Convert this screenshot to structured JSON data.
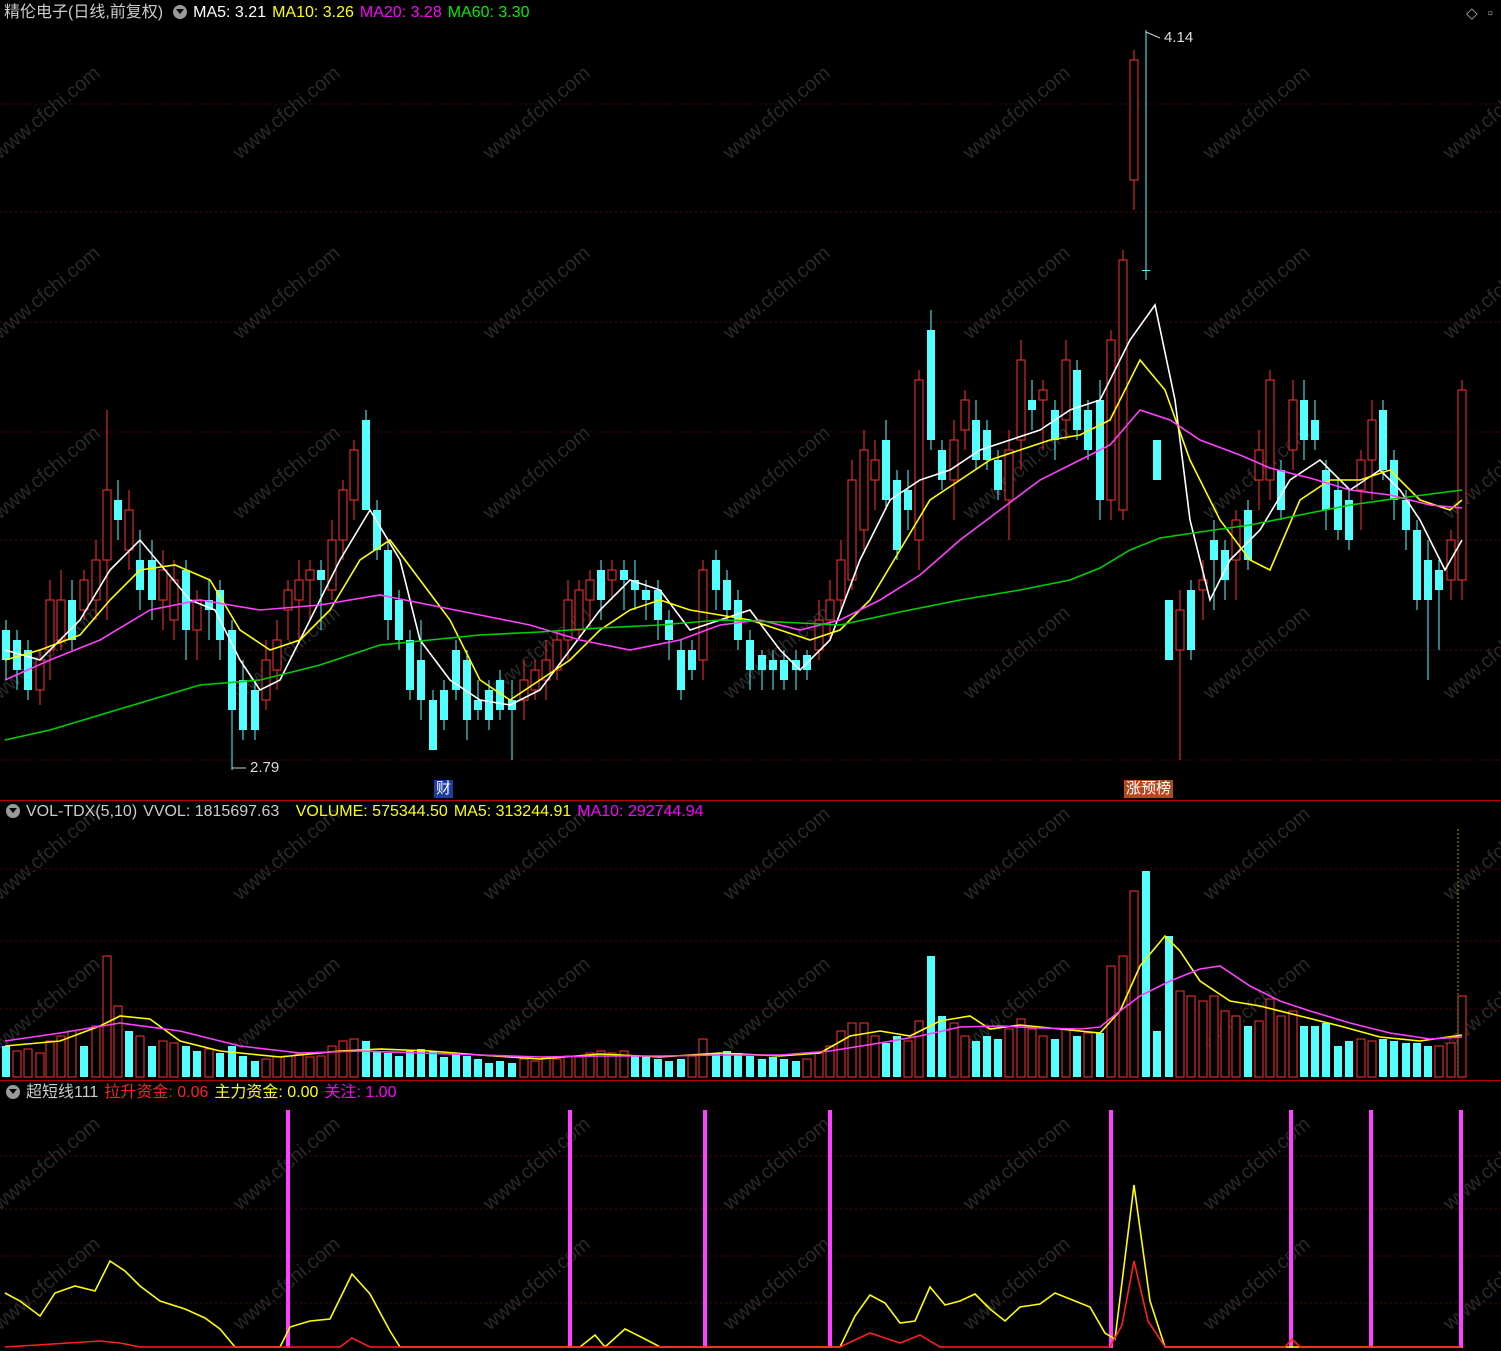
{
  "main": {
    "stock_name": "精伦电子",
    "mode": "(日线,前复权)",
    "ma": [
      {
        "label": "MA5",
        "value": "3.21",
        "color": "#ffffff"
      },
      {
        "label": "MA10",
        "value": "3.26",
        "color": "#ffff00"
      },
      {
        "label": "MA20",
        "value": "3.28",
        "color": "#ff00ff"
      },
      {
        "label": "MA60",
        "value": "3.30",
        "color": "#00e000"
      }
    ],
    "high_label": "4.14",
    "low_label": "2.79",
    "tag_cai": "财",
    "tag_bang": "涨预榜"
  },
  "volume": {
    "title": "VOL-TDX(5,10)",
    "vvol_label": "VVOL",
    "vvol_value": "1815697.63",
    "volume_label": "VOLUME",
    "volume_value": "575344.50",
    "ma5_label": "MA5",
    "ma5_value": "313244.91",
    "ma10_label": "MA10",
    "ma10_value": "292744.94"
  },
  "indicator": {
    "title": "超短线111",
    "lasheng_label": "拉升资金",
    "lasheng_value": "0.06",
    "zhuli_label": "主力资金",
    "zhuli_value": "0.00",
    "guanzhu_label": "关注",
    "guanzhu_value": "1.00"
  },
  "watermark": "www.cfchi.com",
  "colors": {
    "up": "#ff3232",
    "down": "#54ffff",
    "grid": "#5a0000",
    "magenta": "#ff40ff",
    "yellow": "#ffff00"
  }
}
